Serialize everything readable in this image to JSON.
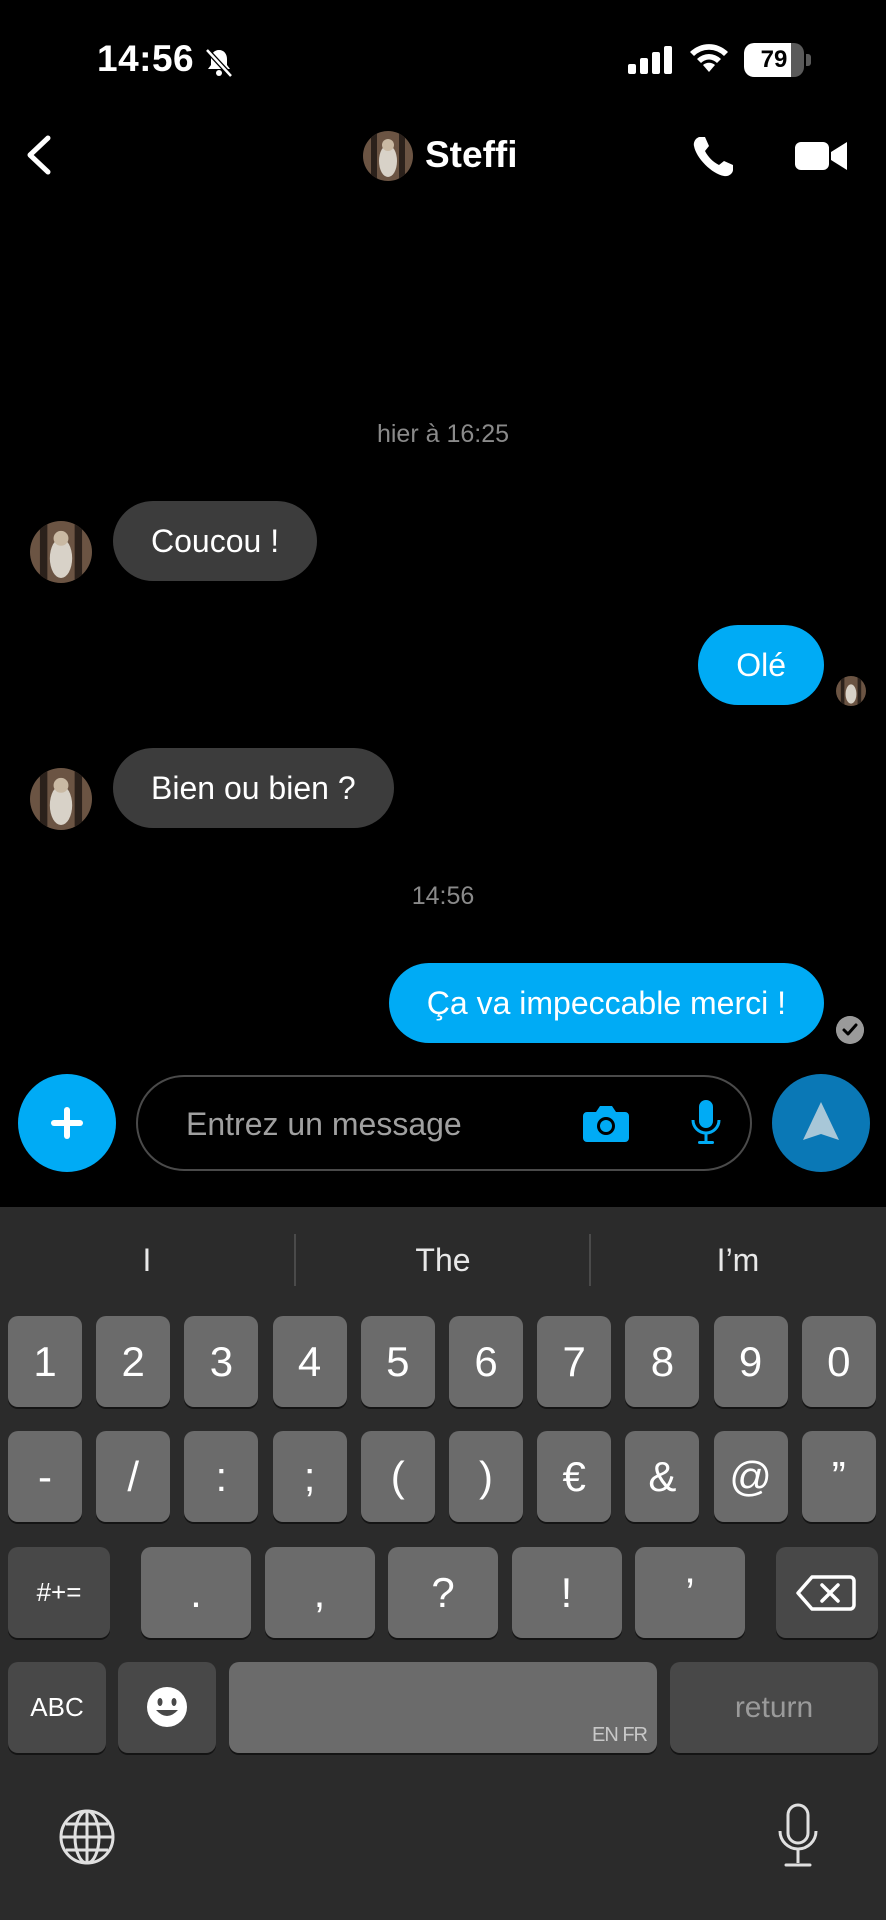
{
  "status_bar": {
    "time": "14:56",
    "battery": 79,
    "battery_label": "79"
  },
  "header": {
    "contact_name": "Steffi"
  },
  "messages": [
    {
      "type": "timestamp",
      "text": "hier à 16:25"
    },
    {
      "type": "incoming",
      "text": "Coucou !"
    },
    {
      "type": "outgoing",
      "text": "Olé"
    },
    {
      "type": "incoming",
      "text": "Bien ou bien ?"
    },
    {
      "type": "timestamp",
      "text": "14:56"
    },
    {
      "type": "outgoing",
      "text": "Ça va impeccable merci !"
    }
  ],
  "composer": {
    "placeholder": "Entrez un message"
  },
  "keyboard": {
    "suggestions": [
      "I",
      "The",
      "I’m"
    ],
    "row1": [
      "1",
      "2",
      "3",
      "4",
      "5",
      "6",
      "7",
      "8",
      "9",
      "0"
    ],
    "row2": [
      "-",
      "/",
      ":",
      ";",
      "(",
      ")",
      "€",
      "&",
      "@",
      "”"
    ],
    "row3": {
      "toggle": "#+=",
      "keys": [
        ".",
        ",",
        "?",
        "!",
        "’"
      ]
    },
    "row4": {
      "abc": "ABC",
      "space_languages": "EN FR",
      "return": "return"
    }
  },
  "colors": {
    "outgoing_bubble": "#00abf5",
    "incoming_bubble": "#3c3c3c",
    "send_button": "#0a78b6"
  },
  "icons": [
    "bell-slash-icon",
    "signal-icon",
    "wifi-icon",
    "back-icon",
    "phone-icon",
    "video-icon",
    "plus-icon",
    "camera-icon",
    "mic-icon",
    "send-icon",
    "delete-icon",
    "emoji-icon",
    "globe-icon",
    "dictation-mic-icon",
    "read-check-icon"
  ]
}
